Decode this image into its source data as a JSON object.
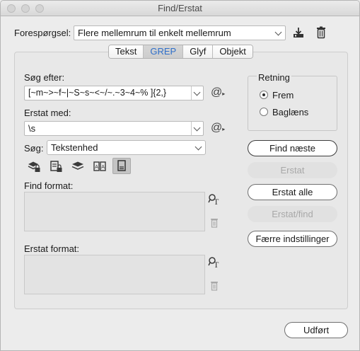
{
  "window": {
    "title": "Find/Erstat"
  },
  "query": {
    "label": "Forespørgsel:",
    "value": "Flere mellemrum til enkelt mellemrum"
  },
  "tabs": [
    {
      "label": "Tekst"
    },
    {
      "label": "GREP"
    },
    {
      "label": "Glyf"
    },
    {
      "label": "Objekt"
    }
  ],
  "find": {
    "label": "Søg efter:",
    "value": "[~m~>~f~|~S~s~<~/~.~3~4~% ]{2,}"
  },
  "replace": {
    "label": "Erstat med:",
    "value": "\\s"
  },
  "search": {
    "label": "Søg:",
    "value": "Tekstenhed"
  },
  "find_format": {
    "label": "Find format:"
  },
  "replace_format": {
    "label": "Erstat format:"
  },
  "direction": {
    "label": "Retning",
    "options": [
      {
        "label": "Frem",
        "selected": true
      },
      {
        "label": "Baglæns",
        "selected": false
      }
    ]
  },
  "buttons": {
    "find_next": "Find næste",
    "replace": "Erstat",
    "replace_all": "Erstat alle",
    "replace_find": "Erstat/find",
    "fewer_options": "Færre indstillinger",
    "done": "Udført"
  },
  "icons": {
    "save_query": "save-query-icon",
    "delete_query": "trash-icon",
    "special_chars": "at-symbol-icon",
    "options": [
      "locked-layers-icon",
      "locked-stories-icon",
      "hidden-layers-icon",
      "master-pages-icon",
      "footnotes-icon"
    ]
  }
}
